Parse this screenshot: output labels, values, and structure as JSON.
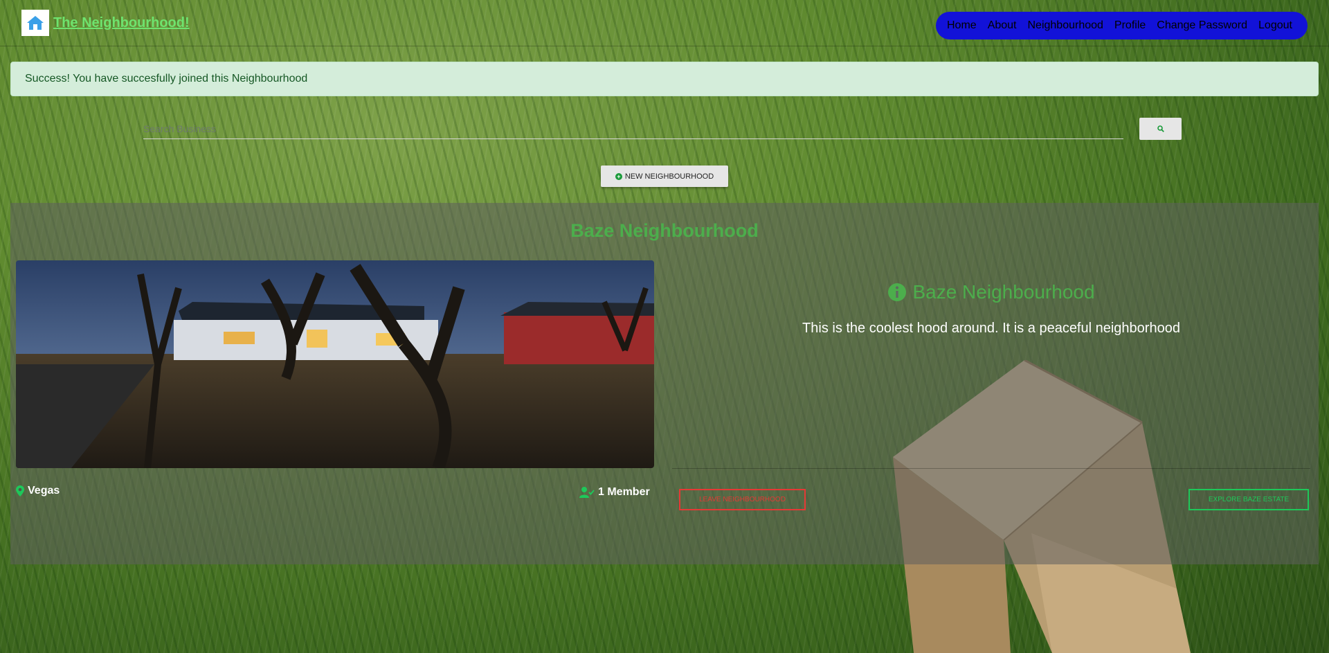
{
  "navbar": {
    "brand": "The Neighbourhood!",
    "links": [
      "Home",
      "About",
      "Neighbourhood",
      "Profile",
      "Change Password",
      "Logout"
    ],
    "pill_color": "#1212d8"
  },
  "alert": {
    "text": "Success! You have succesfully joined this Neighbourhood",
    "type": "success"
  },
  "search": {
    "placeholder": "Search Business",
    "button_icon": "search-icon"
  },
  "new_button": {
    "label": "NEW NEIGHBOURHOOD",
    "icon": "plus-circle-icon"
  },
  "neighbourhood": {
    "title": "Baze Neighbourhood",
    "location": "Vegas",
    "members": "1 Member",
    "info_title": "Baze Neighbourhood",
    "description": "This is the coolest hood around. It is a peaceful neighborhood",
    "leave_label": "LEAVE NEIGHBOURHOOD",
    "explore_label": "EXPLORE BAZE ESTATE"
  },
  "colors": {
    "accent_green": "#4cae4c",
    "danger": "#e53935",
    "success_outline": "#1ec85a",
    "alert_bg": "#d4edda"
  }
}
